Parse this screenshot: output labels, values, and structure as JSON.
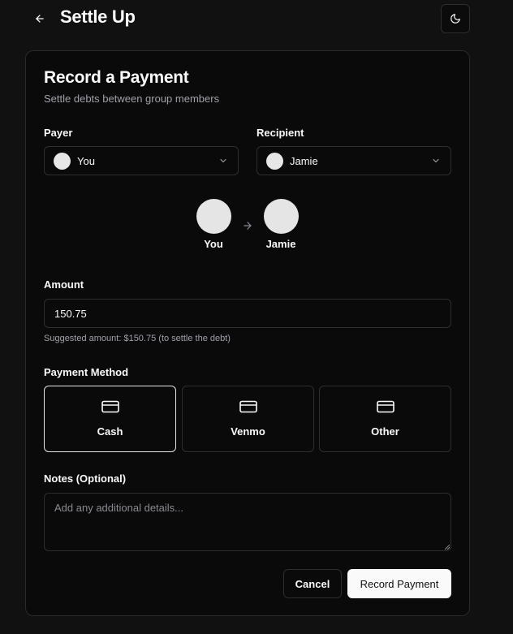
{
  "header": {
    "title": "Settle Up",
    "back_icon": "arrow-left-icon",
    "theme_icon": "moon-icon"
  },
  "card": {
    "title": "Record a Payment",
    "subtitle": "Settle debts between group members"
  },
  "payer": {
    "label": "Payer",
    "selected": "You"
  },
  "recipient": {
    "label": "Recipient",
    "selected": "Jamie"
  },
  "flow": {
    "from": "You",
    "to": "Jamie"
  },
  "amount": {
    "label": "Amount",
    "value": "150.75",
    "hint": "Suggested amount: $150.75 (to settle the debt)"
  },
  "payment_method": {
    "label": "Payment Method",
    "options": [
      "Cash",
      "Venmo",
      "Other"
    ],
    "selected": "Cash"
  },
  "notes": {
    "label": "Notes (Optional)",
    "placeholder": "Add any additional details..."
  },
  "actions": {
    "cancel_label": "Cancel",
    "submit_label": "Record Payment"
  },
  "colors": {
    "background": "#111111",
    "card": "#0a0a0b",
    "border": "#2e2e2e",
    "primary_button": "#fafafa",
    "muted_text": "#a1a1aa"
  }
}
